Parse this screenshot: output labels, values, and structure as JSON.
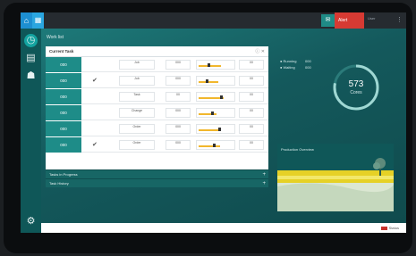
{
  "topbar": {
    "app_icon": "home-icon",
    "app2_icon": "grid-icon",
    "teal_icon": "chat-icon",
    "red_label": "Alert",
    "user_label": "User",
    "menu_icon": "menu-icon"
  },
  "sidebar": {
    "items": [
      {
        "icon": "clock-icon",
        "glyph": "◷"
      },
      {
        "icon": "document-icon",
        "glyph": "▤"
      },
      {
        "icon": "robot-icon",
        "glyph": "☗"
      }
    ],
    "settings_icon": "gear-icon",
    "settings_glyph": "⚙"
  },
  "breadcrumb": "Work list",
  "panel": {
    "title": "Current Task",
    "controls": "ⓘ ✕",
    "rows": [
      {
        "id": "000",
        "glyph": "",
        "c1": "Job",
        "c2": "000",
        "fill": 0.62,
        "marker": 0.25,
        "c3": "00"
      },
      {
        "id": "000",
        "glyph": "✔",
        "c1": "Job",
        "c2": "000",
        "fill": 0.55,
        "marker": 0.2,
        "c3": "00"
      },
      {
        "id": "000",
        "glyph": "",
        "c1": "Task",
        "c2": "00",
        "fill": 0.7,
        "marker": 0.6,
        "c3": "00"
      },
      {
        "id": "000",
        "glyph": "",
        "c1": "Change",
        "c2": "000",
        "fill": 0.5,
        "marker": 0.35,
        "c3": "00"
      },
      {
        "id": "000",
        "glyph": "",
        "c1": "Order",
        "c2": "000",
        "fill": 0.58,
        "marker": 0.55,
        "c3": "00"
      },
      {
        "id": "000",
        "glyph": "✔",
        "c1": "Order",
        "c2": "000",
        "fill": 0.6,
        "marker": 0.4,
        "c3": "00"
      }
    ]
  },
  "sections": [
    {
      "label": "Tasks in Progress",
      "plus": "+"
    },
    {
      "label": "Task History",
      "plus": "+"
    }
  ],
  "stats": [
    {
      "label": "● Running",
      "value": "000"
    },
    {
      "label": "● Waiting",
      "value": "000"
    }
  ],
  "gauge": {
    "value": "573",
    "unit": "Cores",
    "fraction": 0.78,
    "color": "#9fd7d3"
  },
  "card": {
    "title": "Production Overview"
  },
  "statusbar": {
    "label": "Status"
  }
}
